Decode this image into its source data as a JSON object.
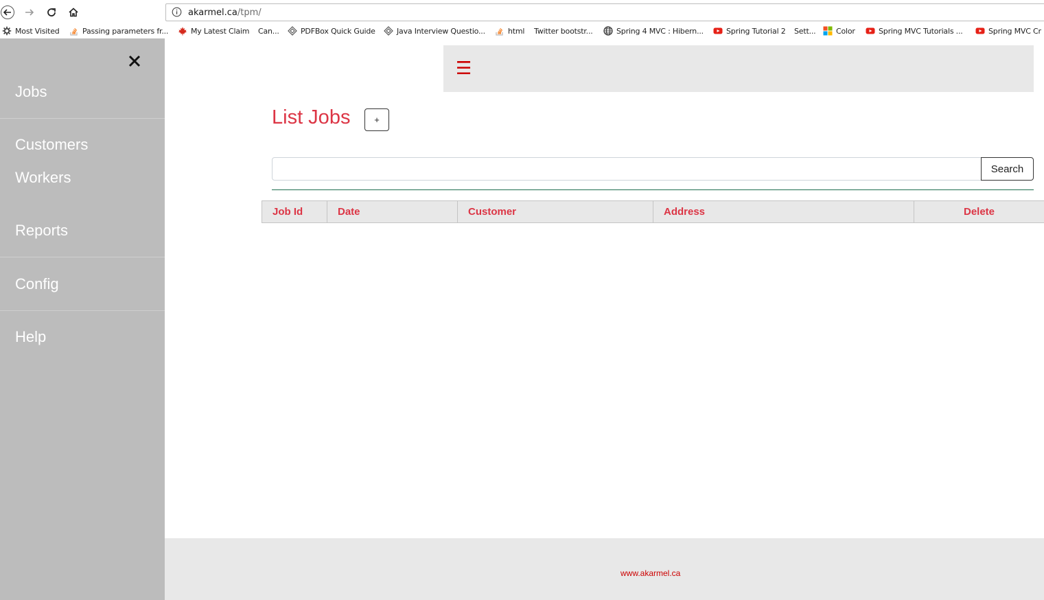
{
  "browser": {
    "url_host": "akarmel.ca",
    "url_path": "/tpm/",
    "bookmarks": [
      {
        "label": "Most Visited",
        "icon": "gear-icon"
      },
      {
        "label": "Passing parameters fr...",
        "icon": "stackoverflow-icon"
      },
      {
        "label": "My Latest Claim",
        "icon": "maple-leaf-icon"
      },
      {
        "label": "Can...",
        "icon": ""
      },
      {
        "label": "PDFBox Quick Guide",
        "icon": "diamond-icon"
      },
      {
        "label": "Java Interview Questio...",
        "icon": "diamond-icon"
      },
      {
        "label": "html",
        "icon": "stackoverflow-icon"
      },
      {
        "label": "Twitter bootstr...",
        "icon": ""
      },
      {
        "label": "Spring 4 MVC : Hibern...",
        "icon": "globe-icon"
      },
      {
        "label": "Spring Tutorial 2",
        "icon": "youtube-icon"
      },
      {
        "label": "Sett...",
        "icon": ""
      },
      {
        "label": "Color",
        "icon": "windows-icon"
      },
      {
        "label": "Spring MVC Tutorials ...",
        "icon": "youtube-icon"
      },
      {
        "label": "Spring MVC Cr",
        "icon": "youtube-icon"
      }
    ]
  },
  "sidebar": {
    "close_icon": "close-icon",
    "items": [
      {
        "label": "Jobs"
      },
      {
        "label": "Customers"
      },
      {
        "label": "Workers"
      },
      {
        "label": "Reports"
      },
      {
        "label": "Config"
      },
      {
        "label": "Help"
      }
    ]
  },
  "topbar": {
    "menu_icon": "hamburger-icon",
    "accent": "#cc0000"
  },
  "main": {
    "title": "List Jobs",
    "add_label": "+",
    "search": {
      "value": "",
      "placeholder": "",
      "button_label": "Search"
    },
    "table": {
      "columns": [
        "Job Id",
        "Date",
        "Customer",
        "Address",
        "Delete"
      ],
      "rows": []
    }
  },
  "footer": {
    "text": "www.akarmel.ca"
  },
  "colors": {
    "title": "#dc3545",
    "sidebar_bg": "#bcbcbc",
    "panel_bg": "#e8e8e8",
    "rule": "#1e6e4e"
  }
}
